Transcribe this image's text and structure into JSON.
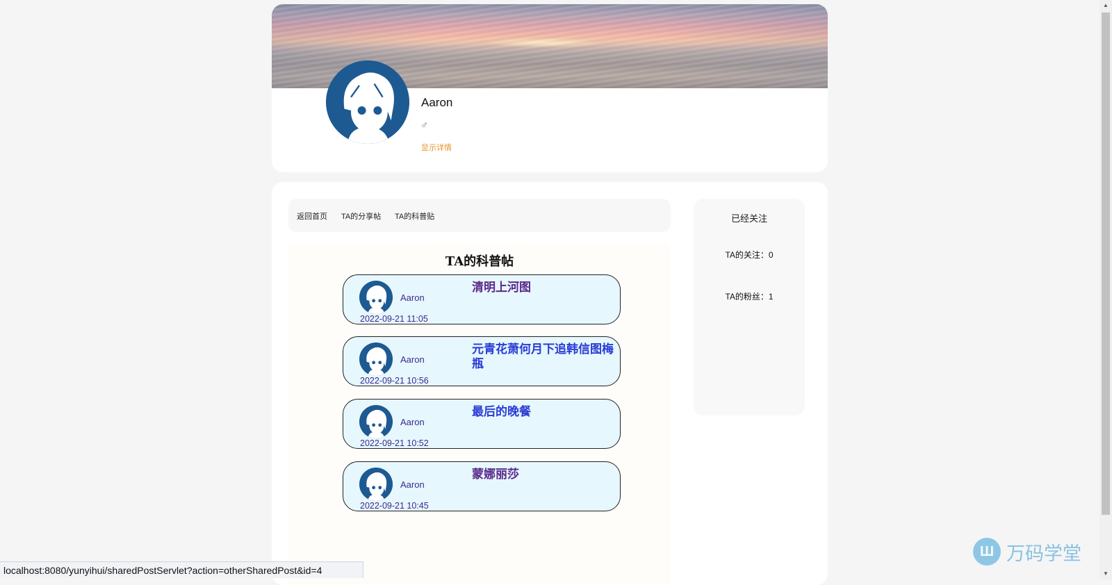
{
  "profile": {
    "name": "Aaron",
    "gender_symbol": "♂",
    "detail_link": "显示详情"
  },
  "tabs": [
    {
      "label": "返回首页"
    },
    {
      "label": "TA的分享帖"
    },
    {
      "label": "TA的科普贴"
    }
  ],
  "posts_section": {
    "title": "TA的科普帖",
    "posts": [
      {
        "author": "Aaron",
        "title": "清明上河图",
        "date": "2022-09-21 11:05"
      },
      {
        "author": "Aaron",
        "title": "元青花萧何月下追韩信图梅瓶",
        "date": "2022-09-21 10:56"
      },
      {
        "author": "Aaron",
        "title": "最后的晚餐",
        "date": "2022-09-21 10:52"
      },
      {
        "author": "Aaron",
        "title": "蒙娜丽莎",
        "date": "2022-09-21 10:45"
      }
    ]
  },
  "follow": {
    "button_label": "已经关注",
    "following_label": "TA的关注：0",
    "followers_label": "TA的粉丝：1"
  },
  "statusbar": {
    "url": "localhost:8080/yunyihui/sharedPostServlet?action=otherSharedPost&id=4"
  },
  "watermark": {
    "logo_glyph": "Ш",
    "text": "万码学堂"
  },
  "colors": {
    "accent_orange": "#e8922c",
    "post_bg": "#e6f7fd",
    "link_blue": "#2a3bd6",
    "link_visited": "#5a2a8a",
    "avatar_blue": "#1d5a92"
  }
}
